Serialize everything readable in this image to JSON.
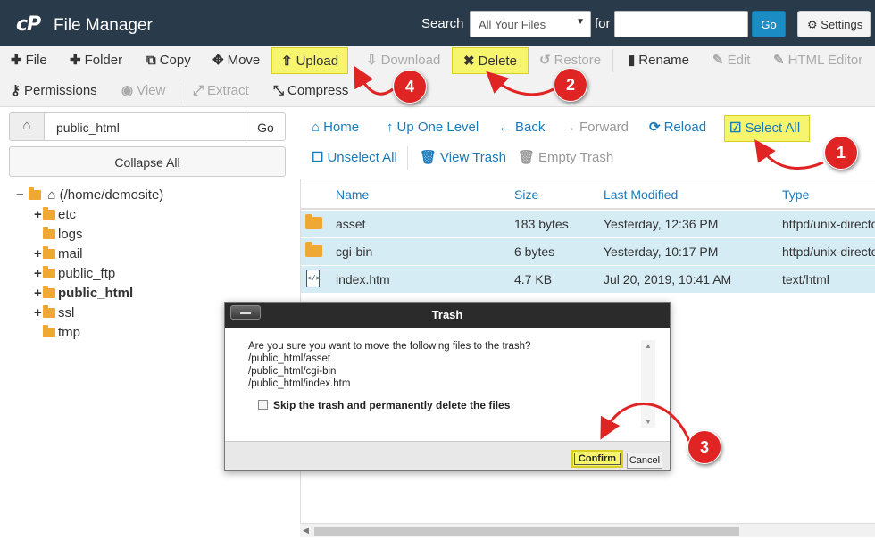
{
  "header": {
    "logo": "cP",
    "title": "File Manager",
    "search_label": "Search",
    "search_scope": "All Your Files",
    "for_label": "for",
    "search_value": "",
    "go_label": "Go",
    "settings_label": "Settings"
  },
  "toolbar": {
    "file": "File",
    "folder": "Folder",
    "copy": "Copy",
    "move": "Move",
    "upload": "Upload",
    "download": "Download",
    "delete": "Delete",
    "restore": "Restore",
    "rename": "Rename",
    "edit": "Edit",
    "html_editor": "HTML Editor",
    "permissions": "Permissions",
    "view": "View",
    "extract": "Extract",
    "compress": "Compress"
  },
  "sidebar": {
    "path": "public_html",
    "go_label": "Go",
    "collapse_label": "Collapse All",
    "root": "(/home/demosite)",
    "items": [
      {
        "label": "etc",
        "expand": "+"
      },
      {
        "label": "logs",
        "expand": ""
      },
      {
        "label": "mail",
        "expand": "+"
      },
      {
        "label": "public_ftp",
        "expand": "+"
      },
      {
        "label": "public_html",
        "expand": "+"
      },
      {
        "label": "ssl",
        "expand": "+"
      },
      {
        "label": "tmp",
        "expand": ""
      }
    ]
  },
  "nav": {
    "home": "Home",
    "up": "Up One Level",
    "back": "Back",
    "forward": "Forward",
    "reload": "Reload",
    "select_all": "Select All",
    "unselect_all": "Unselect All",
    "view_trash": "View Trash",
    "empty_trash": "Empty Trash"
  },
  "table": {
    "headers": [
      "Name",
      "Size",
      "Last Modified",
      "Type"
    ],
    "rows": [
      {
        "name": "asset",
        "size": "183 bytes",
        "modified": "Yesterday, 12:36 PM",
        "type": "httpd/unix-directory",
        "icon": "folder-icon"
      },
      {
        "name": "cgi-bin",
        "size": "6 bytes",
        "modified": "Yesterday, 10:17 PM",
        "type": "httpd/unix-directory",
        "icon": "folder-icon"
      },
      {
        "name": "index.htm",
        "size": "4.7 KB",
        "modified": "Jul 20, 2019, 10:41 AM",
        "type": "text/html",
        "icon": "html-file-icon"
      }
    ]
  },
  "dialog": {
    "title": "Trash",
    "question": "Are you sure you want to move the following files to the trash?",
    "files": [
      "/public_html/asset",
      "/public_html/cgi-bin",
      "/public_html/index.htm"
    ],
    "skip_label": "Skip the trash and permanently delete the files",
    "confirm_label": "Confirm",
    "cancel_label": "Cancel"
  },
  "annotations": {
    "step1": "1",
    "step2": "2",
    "step3": "3",
    "step4": "4"
  },
  "colors": {
    "header_bg": "#293a4a",
    "accent_blue": "#1b8dc4",
    "highlight_yellow": "#f7f56e",
    "selection_blue": "#d6ecf5",
    "annotation_red": "#e02424"
  }
}
